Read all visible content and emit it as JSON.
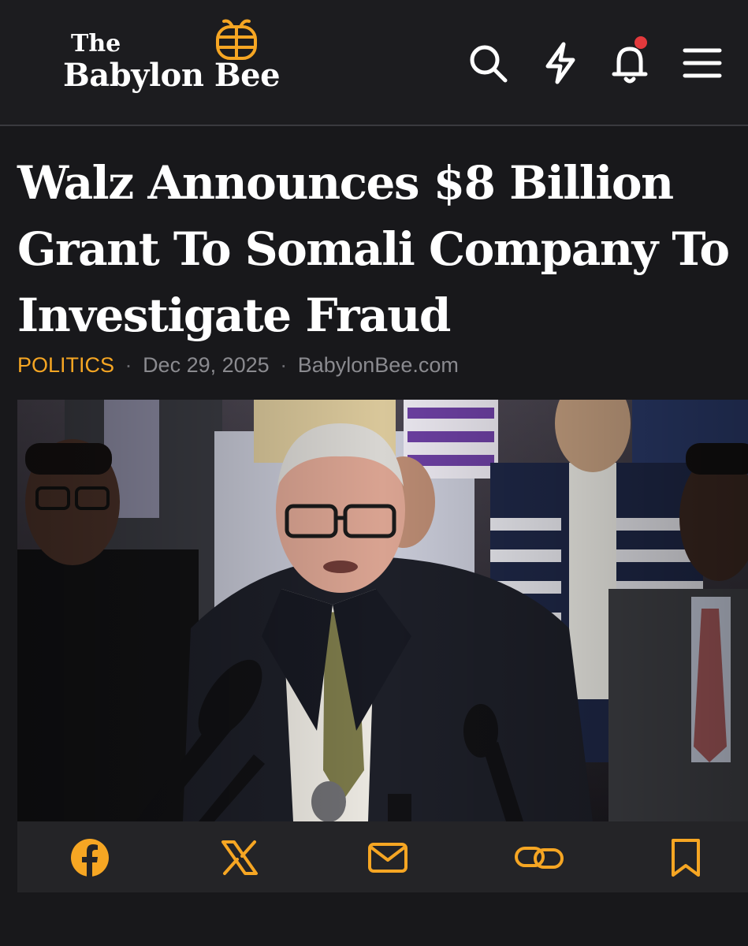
{
  "header": {
    "logo": {
      "line1": "The",
      "line2": "Babylon Bee"
    },
    "icons": [
      "search-icon",
      "lightning-icon",
      "bell-icon",
      "menu-icon"
    ],
    "notification_dot_color": "#e3393c"
  },
  "article": {
    "headline": "Walz Announces $8 Billion Grant To Somali Company To Investigate Fraud",
    "category": "POLITICS",
    "separator": "·",
    "date": "Dec 29, 2025",
    "source": "BabylonBee.com"
  },
  "share_bar": {
    "icons": [
      "facebook-icon",
      "x-icon",
      "mail-icon",
      "link-icon",
      "bookmark-icon"
    ]
  },
  "colors": {
    "background": "#18181b",
    "accent": "#f6a623",
    "headline": "#ffffff",
    "meta_text": "#8a8a8f"
  }
}
